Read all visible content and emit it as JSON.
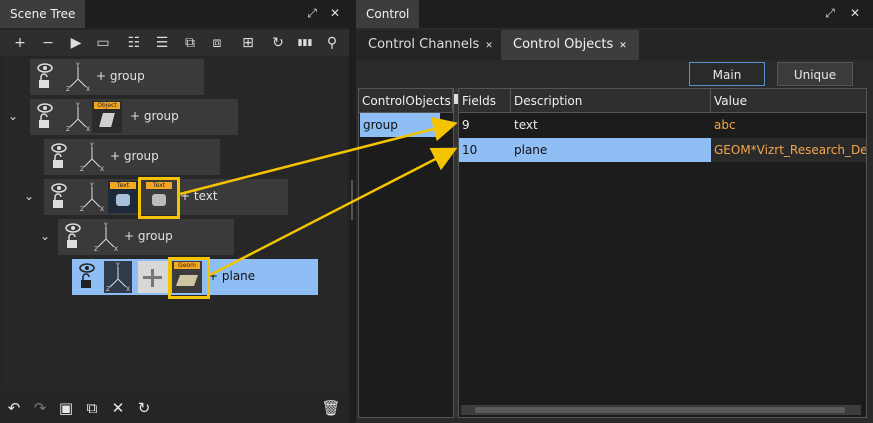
{
  "scene_tree": {
    "title": "Scene Tree",
    "toolbar": {
      "add": "+",
      "remove": "−",
      "play": "▶",
      "refresh": "↻",
      "chart": "▮▮▮",
      "search": "⚲"
    },
    "nodes": [
      {
        "label": "+ group"
      },
      {
        "label": "+ group",
        "thumb_tag": "Object"
      },
      {
        "label": "+ group"
      },
      {
        "label": "+ text",
        "thumb_tag_1": "Text",
        "thumb_tag_2": "Text"
      },
      {
        "label": "+ group"
      },
      {
        "label": "+ plane",
        "thumb_tag": "Geom"
      }
    ]
  },
  "control": {
    "title": "Control",
    "tabs": [
      {
        "label": "Control Channels"
      },
      {
        "label": "Control Objects"
      }
    ],
    "modes": {
      "main": "Main",
      "unique": "Unique"
    },
    "objects_header": "ControlObjects",
    "objects": [
      "group"
    ],
    "columns": {
      "fields": "Fields",
      "description": "Description",
      "value": "Value"
    },
    "rows": [
      {
        "field": "9",
        "description": "text",
        "value": "abc"
      },
      {
        "field": "10",
        "description": "plane",
        "value": "GEOM*Vizrt_Research_Dev"
      }
    ]
  },
  "colors": {
    "accent": "#8fbef5",
    "highlight": "#f4c400",
    "value_text": "#f3a54a"
  }
}
